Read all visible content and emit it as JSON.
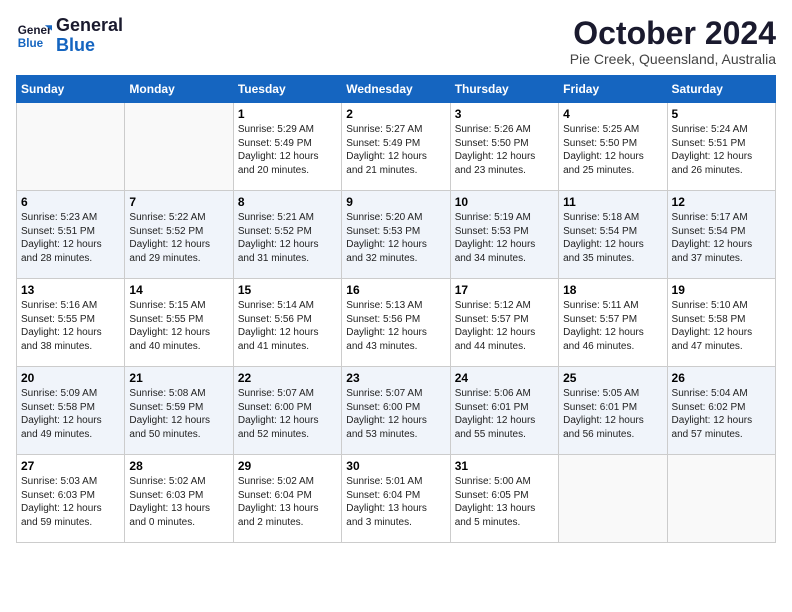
{
  "header": {
    "logo_line1": "General",
    "logo_line2": "Blue",
    "month_title": "October 2024",
    "subtitle": "Pie Creek, Queensland, Australia"
  },
  "days_of_week": [
    "Sunday",
    "Monday",
    "Tuesday",
    "Wednesday",
    "Thursday",
    "Friday",
    "Saturday"
  ],
  "weeks": [
    [
      {
        "day": "",
        "content": ""
      },
      {
        "day": "",
        "content": ""
      },
      {
        "day": "1",
        "content": "Sunrise: 5:29 AM\nSunset: 5:49 PM\nDaylight: 12 hours and 20 minutes."
      },
      {
        "day": "2",
        "content": "Sunrise: 5:27 AM\nSunset: 5:49 PM\nDaylight: 12 hours and 21 minutes."
      },
      {
        "day": "3",
        "content": "Sunrise: 5:26 AM\nSunset: 5:50 PM\nDaylight: 12 hours and 23 minutes."
      },
      {
        "day": "4",
        "content": "Sunrise: 5:25 AM\nSunset: 5:50 PM\nDaylight: 12 hours and 25 minutes."
      },
      {
        "day": "5",
        "content": "Sunrise: 5:24 AM\nSunset: 5:51 PM\nDaylight: 12 hours and 26 minutes."
      }
    ],
    [
      {
        "day": "6",
        "content": "Sunrise: 5:23 AM\nSunset: 5:51 PM\nDaylight: 12 hours and 28 minutes."
      },
      {
        "day": "7",
        "content": "Sunrise: 5:22 AM\nSunset: 5:52 PM\nDaylight: 12 hours and 29 minutes."
      },
      {
        "day": "8",
        "content": "Sunrise: 5:21 AM\nSunset: 5:52 PM\nDaylight: 12 hours and 31 minutes."
      },
      {
        "day": "9",
        "content": "Sunrise: 5:20 AM\nSunset: 5:53 PM\nDaylight: 12 hours and 32 minutes."
      },
      {
        "day": "10",
        "content": "Sunrise: 5:19 AM\nSunset: 5:53 PM\nDaylight: 12 hours and 34 minutes."
      },
      {
        "day": "11",
        "content": "Sunrise: 5:18 AM\nSunset: 5:54 PM\nDaylight: 12 hours and 35 minutes."
      },
      {
        "day": "12",
        "content": "Sunrise: 5:17 AM\nSunset: 5:54 PM\nDaylight: 12 hours and 37 minutes."
      }
    ],
    [
      {
        "day": "13",
        "content": "Sunrise: 5:16 AM\nSunset: 5:55 PM\nDaylight: 12 hours and 38 minutes."
      },
      {
        "day": "14",
        "content": "Sunrise: 5:15 AM\nSunset: 5:55 PM\nDaylight: 12 hours and 40 minutes."
      },
      {
        "day": "15",
        "content": "Sunrise: 5:14 AM\nSunset: 5:56 PM\nDaylight: 12 hours and 41 minutes."
      },
      {
        "day": "16",
        "content": "Sunrise: 5:13 AM\nSunset: 5:56 PM\nDaylight: 12 hours and 43 minutes."
      },
      {
        "day": "17",
        "content": "Sunrise: 5:12 AM\nSunset: 5:57 PM\nDaylight: 12 hours and 44 minutes."
      },
      {
        "day": "18",
        "content": "Sunrise: 5:11 AM\nSunset: 5:57 PM\nDaylight: 12 hours and 46 minutes."
      },
      {
        "day": "19",
        "content": "Sunrise: 5:10 AM\nSunset: 5:58 PM\nDaylight: 12 hours and 47 minutes."
      }
    ],
    [
      {
        "day": "20",
        "content": "Sunrise: 5:09 AM\nSunset: 5:58 PM\nDaylight: 12 hours and 49 minutes."
      },
      {
        "day": "21",
        "content": "Sunrise: 5:08 AM\nSunset: 5:59 PM\nDaylight: 12 hours and 50 minutes."
      },
      {
        "day": "22",
        "content": "Sunrise: 5:07 AM\nSunset: 6:00 PM\nDaylight: 12 hours and 52 minutes."
      },
      {
        "day": "23",
        "content": "Sunrise: 5:07 AM\nSunset: 6:00 PM\nDaylight: 12 hours and 53 minutes."
      },
      {
        "day": "24",
        "content": "Sunrise: 5:06 AM\nSunset: 6:01 PM\nDaylight: 12 hours and 55 minutes."
      },
      {
        "day": "25",
        "content": "Sunrise: 5:05 AM\nSunset: 6:01 PM\nDaylight: 12 hours and 56 minutes."
      },
      {
        "day": "26",
        "content": "Sunrise: 5:04 AM\nSunset: 6:02 PM\nDaylight: 12 hours and 57 minutes."
      }
    ],
    [
      {
        "day": "27",
        "content": "Sunrise: 5:03 AM\nSunset: 6:03 PM\nDaylight: 12 hours and 59 minutes."
      },
      {
        "day": "28",
        "content": "Sunrise: 5:02 AM\nSunset: 6:03 PM\nDaylight: 13 hours and 0 minutes."
      },
      {
        "day": "29",
        "content": "Sunrise: 5:02 AM\nSunset: 6:04 PM\nDaylight: 13 hours and 2 minutes."
      },
      {
        "day": "30",
        "content": "Sunrise: 5:01 AM\nSunset: 6:04 PM\nDaylight: 13 hours and 3 minutes."
      },
      {
        "day": "31",
        "content": "Sunrise: 5:00 AM\nSunset: 6:05 PM\nDaylight: 13 hours and 5 minutes."
      },
      {
        "day": "",
        "content": ""
      },
      {
        "day": "",
        "content": ""
      }
    ]
  ]
}
